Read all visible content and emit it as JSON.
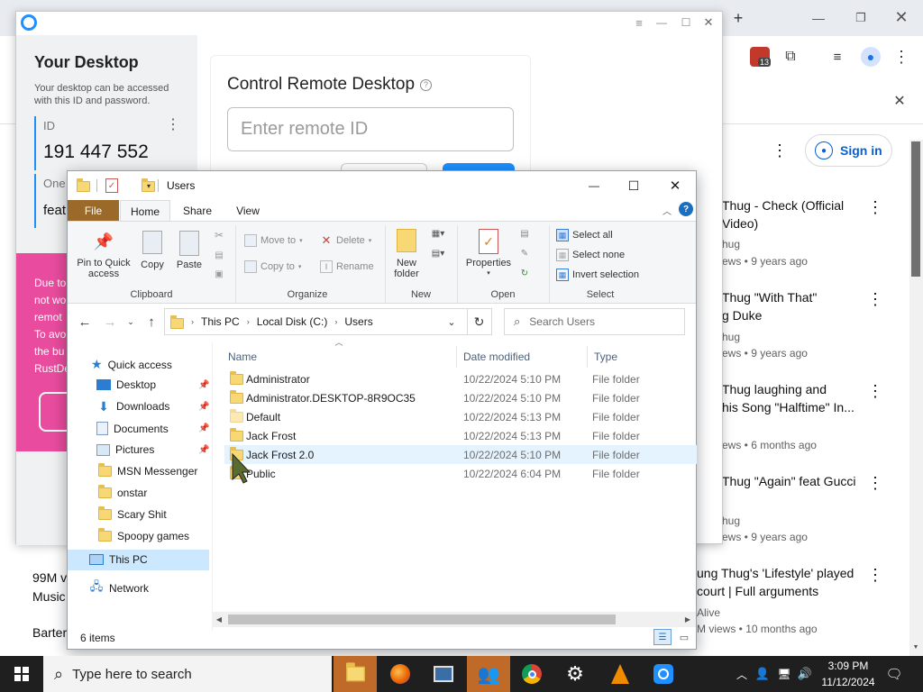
{
  "chrome": {
    "extension_badge": "13"
  },
  "youtube": {
    "sign_in": "Sign in",
    "videos": [
      {
        "title1": "Thug - Check (Official",
        "title2": "Video)",
        "channel": "hug",
        "meta": "ews • 9 years ago"
      },
      {
        "title1": "Thug \"With That\"",
        "title2": "g Duke",
        "channel": "hug",
        "meta": "ews • 9 years ago"
      },
      {
        "title1": "Thug laughing and",
        "title2": " his Song \"Halftime\" In...",
        "channel": "",
        "meta": "ews • 6 months ago"
      },
      {
        "title1": "Thug \"Again\" feat Gucci",
        "title2": "",
        "channel": "hug",
        "meta": "ews • 9 years ago"
      },
      {
        "title1": "ung Thug's 'Lifestyle' played",
        "title2": "court | Full arguments",
        "channel": "Alive",
        "meta": "M views • 10 months ago"
      }
    ],
    "left_views": "99M v",
    "left_cat": "Music",
    "left_channel": "Barter"
  },
  "rustdesk": {
    "your_desktop": "Your Desktop",
    "desc": "Your desktop can be accessed with this ID and password.",
    "id_label": "ID",
    "id_value": "191 447 552",
    "one_label": "One",
    "feat_label": "feat",
    "control_title": "Control Remote Desktop",
    "remote_placeholder": "Enter remote ID",
    "warning_lines": [
      "Due to",
      "not wo",
      "remot",
      "To avo",
      "the bu",
      "RustDe"
    ]
  },
  "explorer": {
    "title": "Users",
    "tabs": {
      "file": "File",
      "home": "Home",
      "share": "Share",
      "view": "View"
    },
    "ribbon": {
      "pin": "Pin to Quick access",
      "copy": "Copy",
      "paste": "Paste",
      "clipboard": "Clipboard",
      "move_to": "Move to",
      "copy_to": "Copy to",
      "delete": "Delete",
      "rename": "Rename",
      "organize": "Organize",
      "new_folder": "New folder",
      "new": "New",
      "properties": "Properties",
      "open": "Open",
      "select_all": "Select all",
      "select_none": "Select none",
      "invert_selection": "Invert selection",
      "select": "Select"
    },
    "breadcrumb": [
      "This PC",
      "Local Disk (C:)",
      "Users"
    ],
    "search_placeholder": "Search Users",
    "columns": {
      "name": "Name",
      "date": "Date modified",
      "type": "Type"
    },
    "nav": {
      "quick_access": "Quick access",
      "items": [
        "Desktop",
        "Downloads",
        "Documents",
        "Pictures",
        "MSN Messenger",
        "onstar",
        "Scary Shit",
        "Spoopy games"
      ],
      "this_pc": "This PC",
      "network": "Network"
    },
    "files": [
      {
        "name": "Administrator",
        "date": "10/22/2024 5:10 PM",
        "type": "File folder"
      },
      {
        "name": "Administrator.DESKTOP-8R9OC35",
        "date": "10/22/2024 5:10 PM",
        "type": "File folder"
      },
      {
        "name": "Default",
        "date": "10/22/2024 5:13 PM",
        "type": "File folder"
      },
      {
        "name": "Jack Frost",
        "date": "10/22/2024 5:13 PM",
        "type": "File folder"
      },
      {
        "name": "Jack Frost 2.0",
        "date": "10/22/2024 5:10 PM",
        "type": "File folder"
      },
      {
        "name": "Public",
        "date": "10/22/2024 6:04 PM",
        "type": "File folder"
      }
    ],
    "status": "6 items"
  },
  "taskbar": {
    "search_placeholder": "Type here to search",
    "time": "3:09 PM",
    "date": "11/12/2024"
  }
}
